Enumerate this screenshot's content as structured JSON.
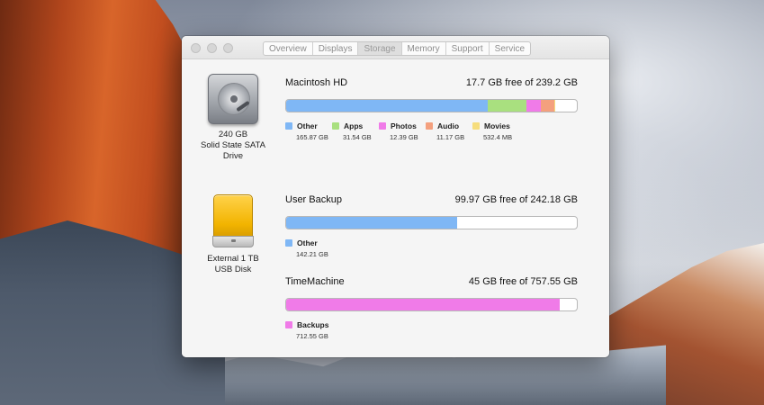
{
  "window": {
    "tabs": [
      {
        "label": "Overview",
        "active": false
      },
      {
        "label": "Displays",
        "active": false
      },
      {
        "label": "Storage",
        "active": true
      },
      {
        "label": "Memory",
        "active": false
      },
      {
        "label": "Support",
        "active": false
      },
      {
        "label": "Service",
        "active": false
      }
    ]
  },
  "colors": {
    "other": "#7fb7f5",
    "apps": "#a9e07f",
    "photos": "#f07be8",
    "audio": "#f4a07e",
    "movies": "#f6dd7c",
    "free": "#ffffff"
  },
  "drives": [
    {
      "icon": "hard-drive-icon",
      "line1": "240 GB",
      "line2": "Solid State SATA",
      "line3": "Drive"
    },
    {
      "icon": "external-drive-icon",
      "line1": "External 1 TB",
      "line2": "USB Disk"
    }
  ],
  "volumes": [
    {
      "name": "Macintosh HD",
      "free_text": "17.7 GB free of 239.2 GB",
      "total_gb": 239.2,
      "categories": [
        {
          "name": "Other",
          "size": "165.87 GB",
          "gb": 165.87,
          "color": "#7fb7f5"
        },
        {
          "name": "Apps",
          "size": "31.54 GB",
          "gb": 31.54,
          "color": "#a9e07f"
        },
        {
          "name": "Photos",
          "size": "12.39 GB",
          "gb": 12.39,
          "color": "#f07be8"
        },
        {
          "name": "Audio",
          "size": "11.17 GB",
          "gb": 11.17,
          "color": "#f4a07e"
        },
        {
          "name": "Movies",
          "size": "532.4 MB",
          "gb": 0.53,
          "color": "#f6dd7c"
        }
      ]
    },
    {
      "name": "User Backup",
      "free_text": "99.97 GB free of 242.18 GB",
      "total_gb": 242.18,
      "categories": [
        {
          "name": "Other",
          "size": "142.21 GB",
          "gb": 142.21,
          "color": "#7fb7f5"
        }
      ]
    },
    {
      "name": "TimeMachine",
      "free_text": "45 GB free of 757.55 GB",
      "total_gb": 757.55,
      "categories": [
        {
          "name": "Backups",
          "size": "712.55 GB",
          "gb": 712.55,
          "color": "#f07be8"
        }
      ]
    }
  ]
}
